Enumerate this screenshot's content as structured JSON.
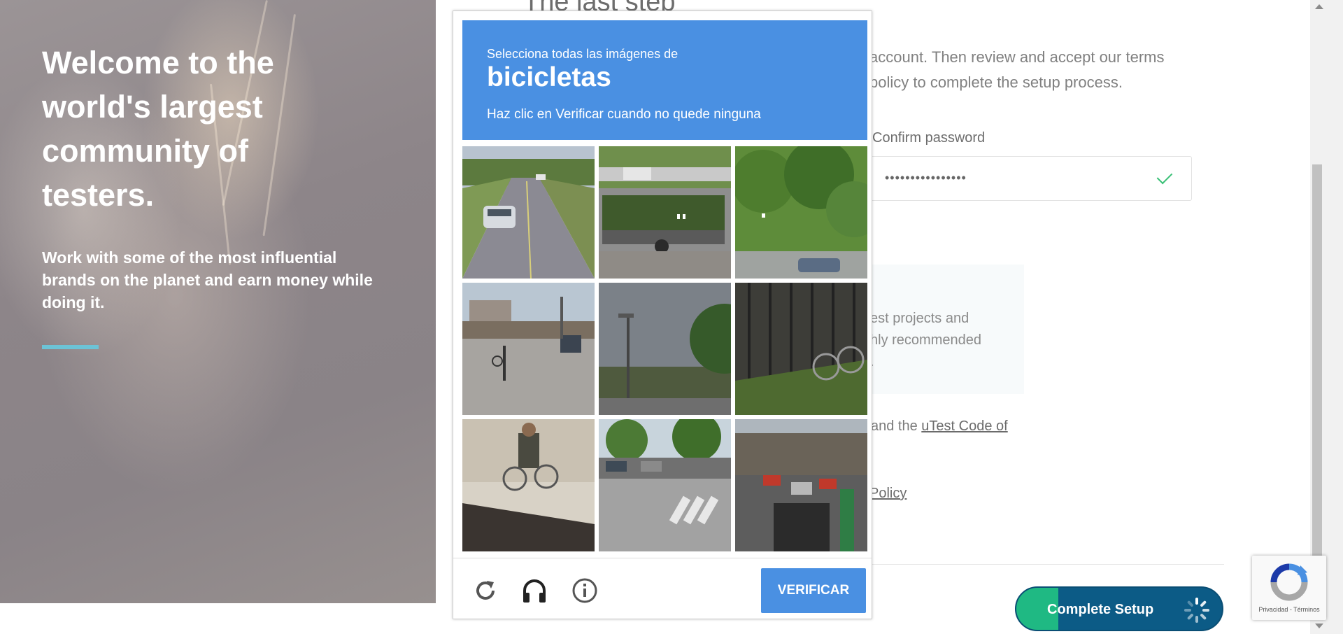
{
  "hero": {
    "title": "Welcome to the world's largest community of testers.",
    "subtitle": "Work with some of the most influential brands on the planet and earn money while doing it."
  },
  "form": {
    "section_title": "The last step",
    "intro_line1": "account. Then review and accept our terms",
    "intro_line2": "policy to complete the setup process.",
    "confirm_password_label": "Confirm password",
    "confirm_password_value": "••••••••••••••••",
    "info_text_line1": "est projects and",
    "info_text_line2": "hly recommended",
    "info_text_line3": ".",
    "terms_prefix": "and the ",
    "terms_link": "uTest Code of",
    "policy_link": "Policy",
    "complete_button": "Complete Setup"
  },
  "captcha": {
    "instruction": "Selecciona todas las imágenes de",
    "keyword": "bicicletas",
    "sub_instruction": "Haz clic en Verificar cuando no quede ninguna",
    "verify_button": "VERIFICAR",
    "tiles": [
      {
        "scene": "road-car"
      },
      {
        "scene": "truck-plants"
      },
      {
        "scene": "trees-car"
      },
      {
        "scene": "intersection-cyclist"
      },
      {
        "scene": "streetlight-sky"
      },
      {
        "scene": "bike-fence"
      },
      {
        "scene": "cyclist-sidewalk"
      },
      {
        "scene": "parking-lot-crosswalk"
      },
      {
        "scene": "traffic-street"
      }
    ],
    "footer_icons": [
      "reload-icon",
      "headphones-icon",
      "info-icon"
    ]
  },
  "recaptcha_badge": {
    "terms": "Privacidad - Términos"
  },
  "colors": {
    "captcha_blue": "#4a90e2",
    "complete_green": "#1fb983",
    "complete_navy": "#0c5b86",
    "hero_accent": "#6cc3d6",
    "check_green": "#39c076"
  }
}
